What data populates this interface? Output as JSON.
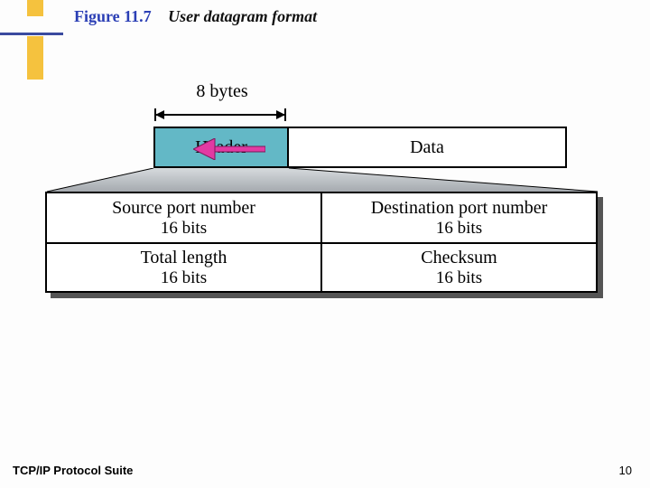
{
  "title": {
    "figure": "Figure 11.7",
    "caption": "User datagram format"
  },
  "diagram": {
    "bytes_label": "8 bytes",
    "header_label": "Header",
    "data_label": "Data",
    "fields": [
      [
        {
          "name": "Source port number",
          "bits": "16 bits"
        },
        {
          "name": "Destination port number",
          "bits": "16 bits"
        }
      ],
      [
        {
          "name": "Total length",
          "bits": "16 bits"
        },
        {
          "name": "Checksum",
          "bits": "16 bits"
        }
      ]
    ],
    "arrow_color": "#e23aa3"
  },
  "footer": {
    "left": "TCP/IP Protocol Suite",
    "page": "10"
  }
}
